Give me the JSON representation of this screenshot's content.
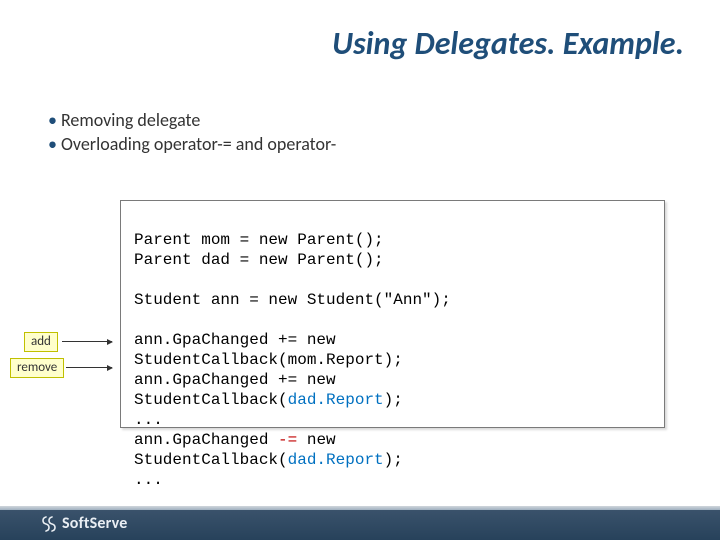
{
  "title": "Using Delegates. Example.",
  "bullets": {
    "b1": "Removing delegate",
    "b2": "Overloading  operator-=  and operator-"
  },
  "code": {
    "l1": "Parent mom = new Parent();",
    "l2": "Parent dad = new Parent();",
    "l3": "",
    "l4": "Student ann = new Student(\"Ann\");",
    "l5": "",
    "l6": "ann.GpaChanged += new",
    "l7": "StudentCallback(mom.Report);",
    "l8": "ann.GpaChanged += new",
    "l9a": "StudentCallback(",
    "l9b": "dad.Report",
    "l9c": ");",
    "l10": "...",
    "l11a": "ann.GpaChanged ",
    "l11b": "-=",
    "l11c": " new",
    "l12a": "StudentCallback(",
    "l12b": "dad.Report",
    "l12c": ");",
    "l13": "..."
  },
  "tags": {
    "add": "add",
    "remove": "remove"
  },
  "brand": "SoftServe"
}
